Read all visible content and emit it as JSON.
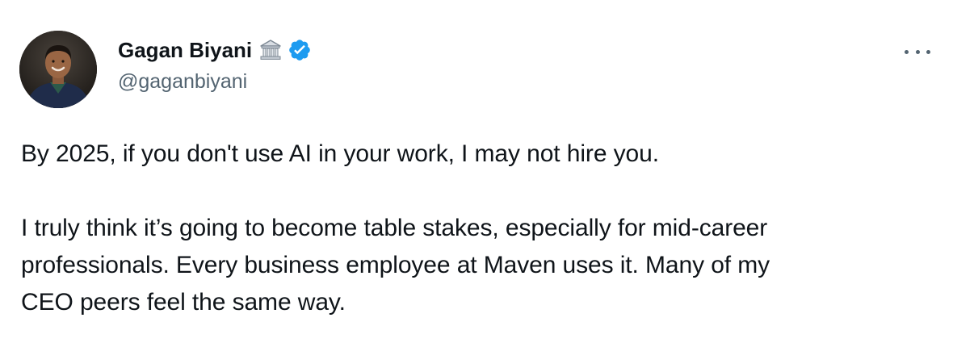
{
  "author": {
    "name": "Gagan Biyani",
    "handle": "@gaganbiyani",
    "badge_icon": "classical-building-icon",
    "verified_icon": "verified-badge-icon",
    "verified_color": "#1d9bf0"
  },
  "menu": {
    "icon": "more-options-icon"
  },
  "tweet": {
    "paragraphs": [
      "By 2025, if you don't use AI in your work, I may not hire you.",
      "I truly think it’s going to become table stakes, especially for mid-career\nprofessionals. Every business employee at Maven uses it. Many of my\nCEO peers feel the same way."
    ]
  },
  "colors": {
    "text": "#0f1419",
    "secondary": "#536471",
    "background": "#ffffff"
  }
}
